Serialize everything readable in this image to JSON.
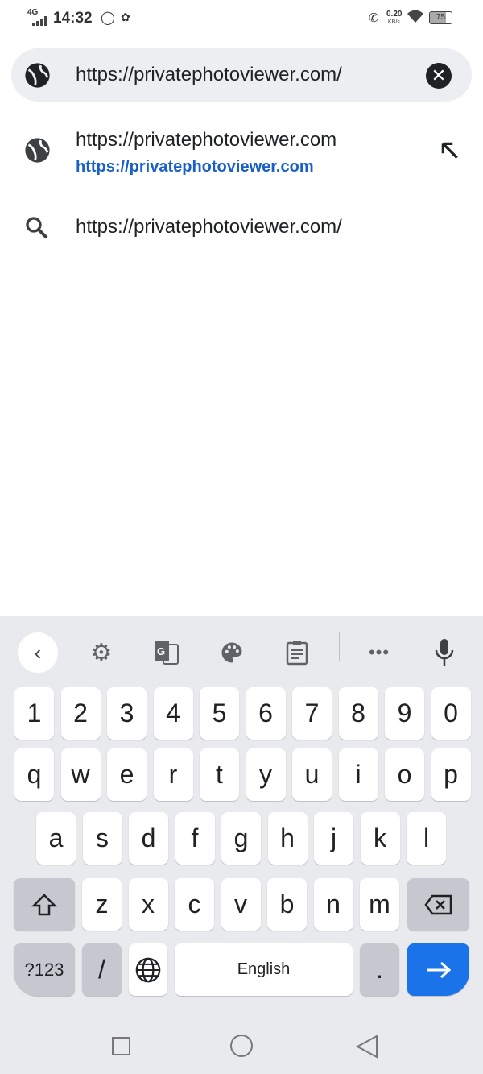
{
  "status_bar": {
    "network": "4G",
    "time": "14:32",
    "speed": "0.20",
    "speed_unit": "KB/s",
    "battery": "75"
  },
  "omnibox": {
    "value": "https://privatephotoviewer.com/",
    "clear_icon": "close-icon"
  },
  "suggestions": [
    {
      "icon": "globe-icon",
      "title": "https://privatephotoviewer.com",
      "url": "https://privatephotoviewer.com",
      "action_icon": "arrow-up-left-icon"
    },
    {
      "icon": "search-icon",
      "title": "https://privatephotoviewer.com/"
    }
  ],
  "keyboard": {
    "toolbar": [
      "back",
      "settings",
      "translate",
      "theme",
      "clipboard",
      "more",
      "mic"
    ],
    "row1": [
      "1",
      "2",
      "3",
      "4",
      "5",
      "6",
      "7",
      "8",
      "9",
      "0"
    ],
    "row2": [
      "q",
      "w",
      "e",
      "r",
      "t",
      "y",
      "u",
      "i",
      "o",
      "p"
    ],
    "row3": [
      "a",
      "s",
      "d",
      "f",
      "g",
      "h",
      "j",
      "k",
      "l"
    ],
    "row4": [
      "z",
      "x",
      "c",
      "v",
      "b",
      "n",
      "m"
    ],
    "symbols_label": "?123",
    "slash": "/",
    "space_label": "English",
    "period": ".",
    "accent_color": "#1a73e8"
  }
}
